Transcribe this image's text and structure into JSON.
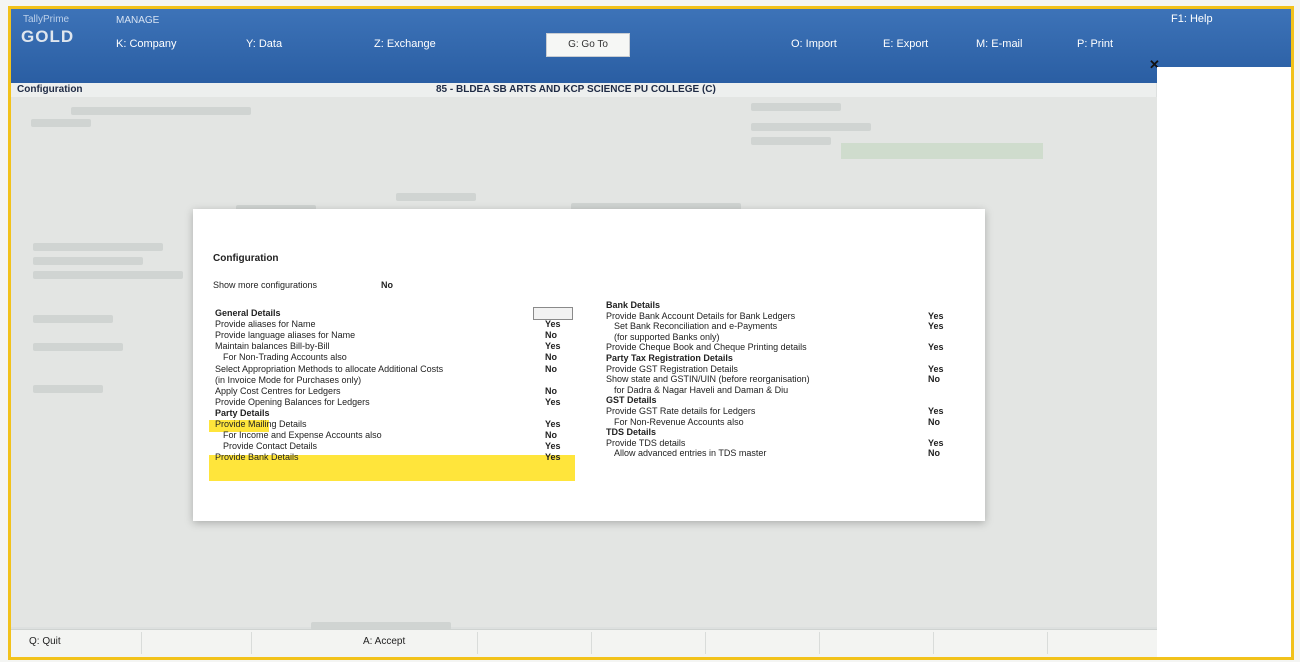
{
  "topbar": {
    "brand_small": "TallyPrime",
    "brand_gold": "GOLD",
    "manage_label": "MANAGE",
    "menu": {
      "company": "K: Company",
      "data": "Y: Data",
      "exchange": "Z: Exchange",
      "goto": "G: Go To",
      "import": "O: Import",
      "export": "E: Export",
      "email": "M: E-mail",
      "print": "P: Print",
      "help": "F1: Help"
    }
  },
  "titlebar": {
    "left": "Configuration",
    "center": "85 - BLDEA SB ARTS AND KCP SCIENCE PU COLLEGE (C)"
  },
  "dialog": {
    "title": "Configuration",
    "show_more_label": "Show more configurations",
    "show_more_value": "No",
    "left_rows": [
      {
        "label": "General Details",
        "value": "",
        "bold": true,
        "indent": false,
        "hl": false
      },
      {
        "label": "Provide aliases for Name",
        "value": "Yes",
        "bold": false,
        "indent": false,
        "hl": false
      },
      {
        "label": "Provide language aliases for Name",
        "value": "No",
        "bold": false,
        "indent": false,
        "hl": false
      },
      {
        "label": "Maintain balances Bill-by-Bill",
        "value": "Yes",
        "bold": false,
        "indent": false,
        "hl": false
      },
      {
        "label": "For Non-Trading Accounts also",
        "value": "No",
        "bold": false,
        "indent": true,
        "hl": false
      },
      {
        "label": "Select Appropriation Methods to allocate Additional Costs",
        "value": "No",
        "bold": false,
        "indent": false,
        "hl": false
      },
      {
        "label": "(in Invoice Mode for Purchases only)",
        "value": "",
        "bold": false,
        "indent": false,
        "hl": false
      },
      {
        "label": "Apply Cost Centres for Ledgers",
        "value": "No",
        "bold": false,
        "indent": false,
        "hl": false
      },
      {
        "label": "Provide Opening Balances for Ledgers",
        "value": "Yes",
        "bold": false,
        "indent": false,
        "hl": false
      },
      {
        "label": "Party Details",
        "value": "",
        "bold": true,
        "indent": false,
        "hl": true
      },
      {
        "label": "Provide Mailing Details",
        "value": "Yes",
        "bold": false,
        "indent": false,
        "hl": false
      },
      {
        "label": "For Income and Expense Accounts also",
        "value": "No",
        "bold": false,
        "indent": true,
        "hl": false
      },
      {
        "label": "Provide Contact Details",
        "value": "Yes",
        "bold": false,
        "indent": true,
        "hl": true
      },
      {
        "label": "Provide Bank Details",
        "value": "Yes",
        "bold": false,
        "indent": false,
        "hl": true
      }
    ],
    "right_rows": [
      {
        "label": "Bank Details",
        "value": "",
        "bold": true,
        "indent": false
      },
      {
        "label": "Provide Bank Account Details for Bank Ledgers",
        "value": "Yes",
        "bold": false,
        "indent": false
      },
      {
        "label": "Set Bank Reconciliation and e-Payments",
        "value": "Yes",
        "bold": false,
        "indent": true
      },
      {
        "label": "(for supported Banks only)",
        "value": "",
        "bold": false,
        "indent": true
      },
      {
        "label": "Provide Cheque Book and Cheque Printing details",
        "value": "Yes",
        "bold": false,
        "indent": false
      },
      {
        "label": "Party Tax Registration Details",
        "value": "",
        "bold": true,
        "indent": false
      },
      {
        "label": "Provide GST Registration Details",
        "value": "Yes",
        "bold": false,
        "indent": false
      },
      {
        "label": "Show state and GSTIN/UIN (before reorganisation)",
        "value": "No",
        "bold": false,
        "indent": false
      },
      {
        "label": "for Dadra & Nagar Haveli and Daman & Diu",
        "value": "",
        "bold": false,
        "indent": true
      },
      {
        "label": "GST Details",
        "value": "",
        "bold": true,
        "indent": false
      },
      {
        "label": "Provide GST Rate details for Ledgers",
        "value": "Yes",
        "bold": false,
        "indent": false
      },
      {
        "label": "For Non-Revenue Accounts also",
        "value": "No",
        "bold": false,
        "indent": true
      },
      {
        "label": "TDS Details",
        "value": "",
        "bold": true,
        "indent": false
      },
      {
        "label": "Provide TDS details",
        "value": "Yes",
        "bold": false,
        "indent": false
      },
      {
        "label": "Allow advanced entries in TDS master",
        "value": "No",
        "bold": false,
        "indent": true
      }
    ]
  },
  "bottombar": {
    "quit": "Q: Quit",
    "accept": "A: Accept"
  },
  "colors": {
    "topbar": "#2f66ad",
    "highlight": "#ffe53b",
    "frame": "#f2c21b"
  }
}
